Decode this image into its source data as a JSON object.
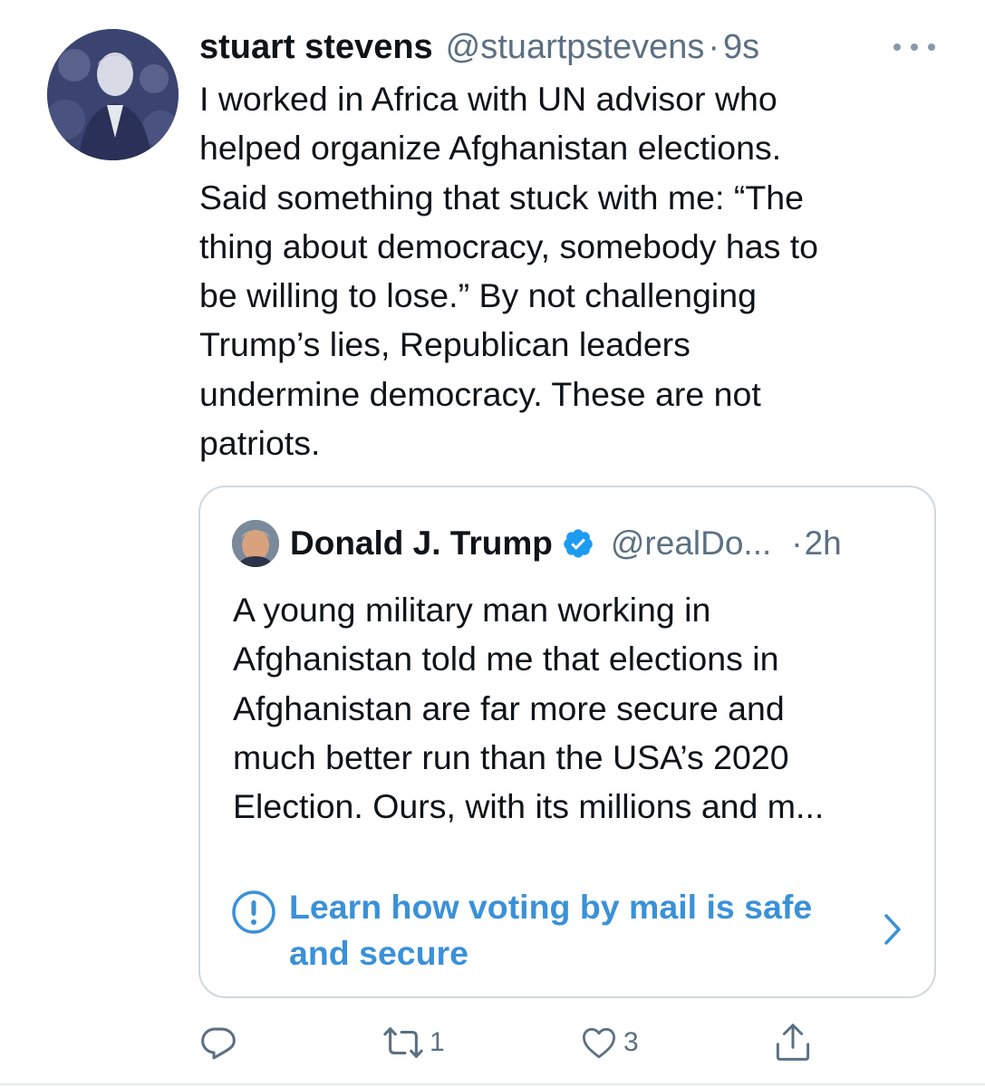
{
  "tweet": {
    "display_name": "stuart stevens",
    "handle": "@stuartpstevens",
    "separator": "·",
    "time": "9s",
    "text": "I worked in Africa with UN advisor who\nhelped organize Afghanistan elections.\nSaid something that stuck with me: “The\nthing about democracy, somebody has to\nbe willing to lose.” By not challenging\nTrump’s lies, Republican leaders\nundermine democracy. These are not\npatriots."
  },
  "quoted_tweet": {
    "display_name": "Donald J. Trump",
    "handle": "@realDo...",
    "separator": "·",
    "time": "2h",
    "text": "A young military man working in\nAfghanistan told me that elections in\nAfghanistan are far more secure and\nmuch better run than the USA’s 2020\nElection. Ours, with its millions and m...",
    "notice": "Learn how voting by mail is safe\nand secure"
  },
  "actions": {
    "replies": "",
    "retweets": "1",
    "likes": "3"
  },
  "colors": {
    "text": "#0f1419",
    "secondary": "#5b7083",
    "link": "#3a91d8",
    "verified": "#1d9bf0",
    "border": "#cfd9de"
  },
  "icons": [
    "more-icon",
    "verified-icon",
    "info-icon",
    "chevron-right-icon",
    "reply-icon",
    "retweet-icon",
    "like-icon",
    "share-icon"
  ]
}
